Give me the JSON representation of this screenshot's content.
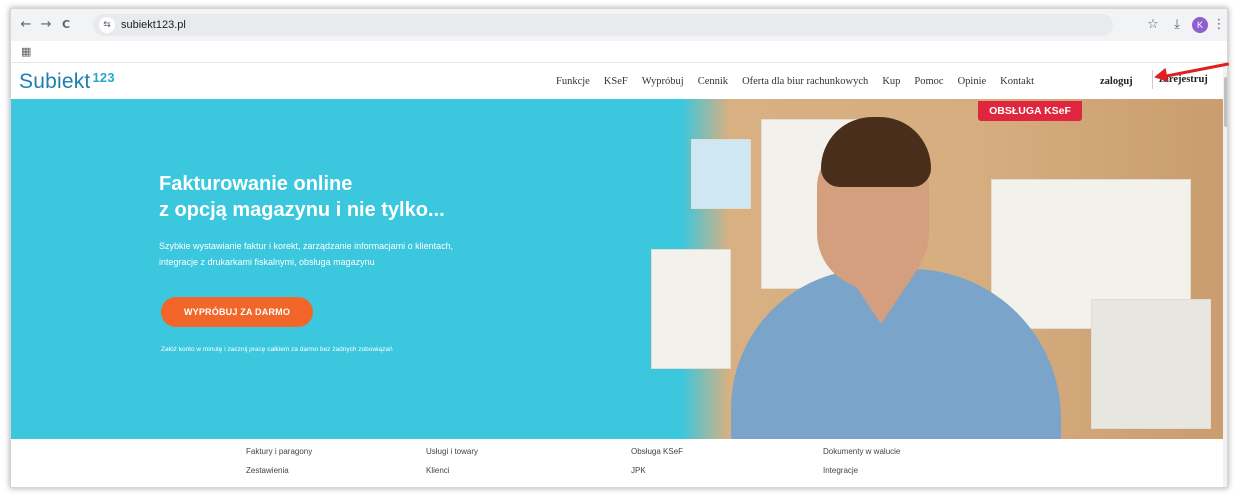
{
  "browser": {
    "url": "subiekt123.pl",
    "icons": {
      "back": "←",
      "forward": "→",
      "reload": "C",
      "site_info": "⇆",
      "star": "☆",
      "download": "⤓",
      "menu": "⋮",
      "apps": "▦"
    },
    "avatar_letter": "K",
    "avatar_color": "#8e5fd0"
  },
  "site": {
    "logo_text": "Subiekt",
    "logo_number": "123",
    "menu": [
      "Funkcje",
      "KSeF",
      "Wypróbuj",
      "Cennik",
      "Oferta dla biur rachunkowych",
      "Kup",
      "Pomoc",
      "Opinie",
      "Kontakt"
    ],
    "login": "zaloguj",
    "register": "zarejestruj"
  },
  "hero": {
    "badge": "OBSŁUGA KSeF",
    "title_line1": "Fakturowanie online",
    "title_line2": "z opcją magazynu i nie tylko...",
    "desc_line1": "Szybkie wystawianie faktur i korekt, zarządzanie informacjami o klientach,",
    "desc_line2": "integracje z drukarkami fiskalnymi, obsługa magazynu",
    "cta": "WYPRÓBUJ ZA DARMO",
    "note": "Załóż konto w minutę i zacznij pracę całkiem za darmo bez żadnych zobowiązań",
    "background_color": "#3bc7de",
    "cta_color": "#f26729",
    "badge_color": "#e0263f"
  },
  "features": [
    [
      "Faktury i paragony",
      "Zestawienia"
    ],
    [
      "Usługi i towary",
      "Klienci"
    ],
    [
      "Obsługa KSeF",
      "JPK"
    ],
    [
      "Dokumenty w walucie",
      "Integracje"
    ]
  ],
  "annotation": {
    "arrow_color": "#e02020"
  }
}
